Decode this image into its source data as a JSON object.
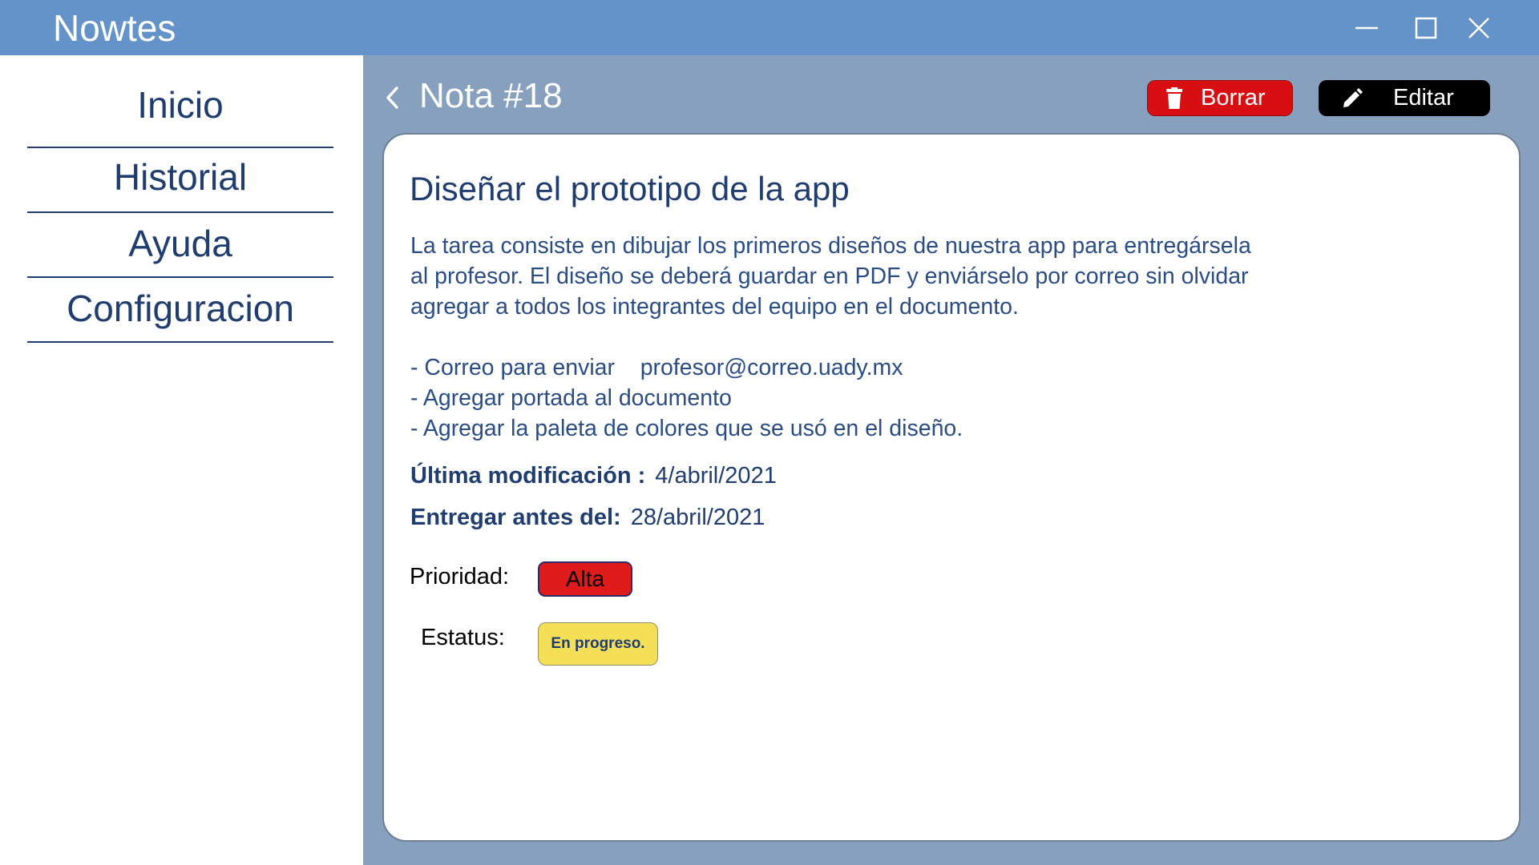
{
  "app": {
    "title": "Nowtes"
  },
  "window_controls": {
    "minimize_icon": "minimize-icon",
    "maximize_icon": "maximize-icon",
    "close_icon": "close-icon"
  },
  "sidebar": {
    "items": [
      {
        "label": "Inicio"
      },
      {
        "label": "Historial"
      },
      {
        "label": "Ayuda"
      },
      {
        "label": "Configuracion"
      }
    ]
  },
  "header": {
    "back_icon": "chevron-left-icon",
    "title": "Nota #18",
    "delete_label": "Borrar",
    "delete_icon": "trash-icon",
    "edit_label": "Editar",
    "edit_icon": "pencil-icon"
  },
  "note": {
    "title": "Diseñar el prototipo de la app",
    "description_lines": [
      "La tarea consiste en dibujar los primeros diseños de nuestra app para entregársela",
      "al profesor. El diseño se deberá guardar en PDF y enviárselo por correo sin olvidar",
      "agregar a todos los integrantes del equipo en el documento."
    ],
    "bullets": [
      "- Correo para enviar    profesor@correo.uady.mx",
      "- Agregar portada al documento",
      "- Agregar la paleta de colores que se usó en el diseño."
    ],
    "last_modified_label": "Última modificación :",
    "last_modified_value": "4/abril/2021",
    "due_label": "Entregar antes del:",
    "due_value": "28/abril/2021",
    "priority_label": "Prioridad:",
    "priority_value": "Alta",
    "status_label": "Estatus:",
    "status_value": "En progreso."
  },
  "colors": {
    "titlebar": "#6493c9",
    "main_background": "#86a0bd",
    "text_primary": "#1f3d6f",
    "delete_button": "#d80f12",
    "edit_button": "#000000",
    "priority_high": "#e01b1b",
    "status_in_progress": "#f4df56"
  }
}
